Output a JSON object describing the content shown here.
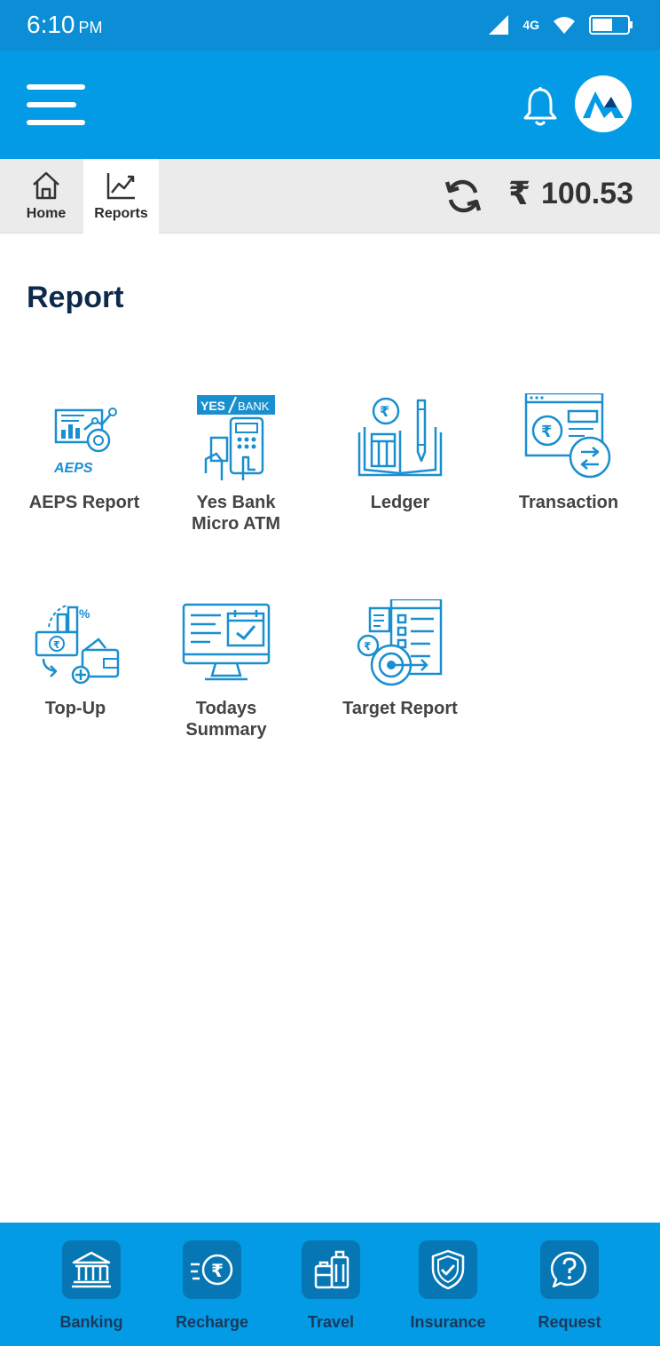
{
  "status_bar": {
    "time": "6:10",
    "ampm": "PM",
    "network": "4G"
  },
  "tabs": [
    {
      "label": "Home",
      "icon": "home-icon"
    },
    {
      "label": "Reports",
      "icon": "trending-chart-icon"
    }
  ],
  "wallet": {
    "currency": "₹",
    "balance": "100.53"
  },
  "section_title": "Report",
  "report_items": [
    {
      "label": "AEPS Report",
      "icon": "aeps-report-icon",
      "badge": "AEPS"
    },
    {
      "label": "Yes Bank Micro ATM",
      "icon": "yes-bank-micro-atm-icon",
      "badge_left": "YES",
      "badge_right": "BANK"
    },
    {
      "label": "Ledger",
      "icon": "ledger-book-icon"
    },
    {
      "label": "Transaction",
      "icon": "transaction-icon"
    },
    {
      "label": "Top-Up",
      "icon": "top-up-wallet-icon"
    },
    {
      "label": "Todays Summary",
      "icon": "summary-monitor-calendar-icon"
    },
    {
      "label": "Target Report",
      "icon": "target-report-icon"
    }
  ],
  "bottom_nav": [
    {
      "label": "Banking",
      "icon": "bank-icon"
    },
    {
      "label": "Recharge",
      "icon": "rupee-speed-icon"
    },
    {
      "label": "Travel",
      "icon": "luggage-icon"
    },
    {
      "label": "Insurance",
      "icon": "shield-check-icon"
    },
    {
      "label": "Request",
      "icon": "question-bubble-icon"
    }
  ],
  "colors": {
    "primary": "#039be5",
    "status_bar": "#0b8ed6",
    "icon_blue": "#1a8fd0",
    "title_dark": "#0d2a4a",
    "nav_icon_bg": "#0677b4"
  }
}
